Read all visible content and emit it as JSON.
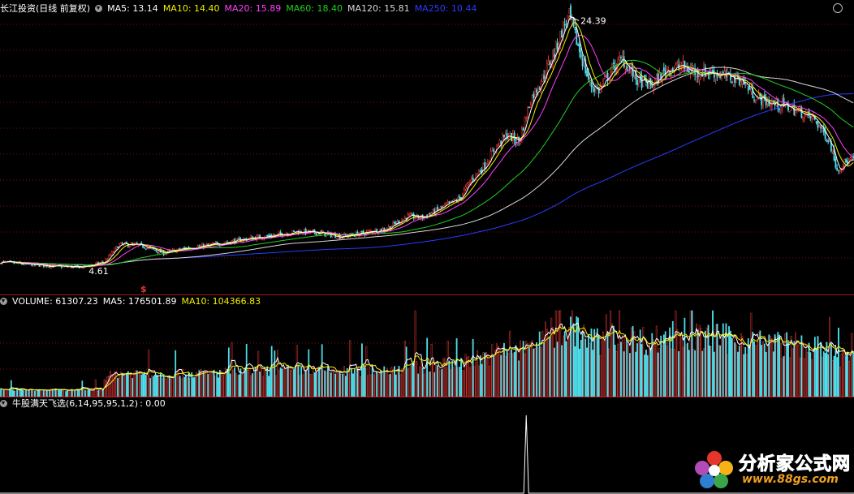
{
  "price_header": {
    "title": "长江投资(日线 前复权)",
    "ma5": "MA5: 13.14",
    "ma10": "MA10: 14.40",
    "ma20": "MA20: 15.89",
    "ma60": "MA60: 18.40",
    "ma120": "MA120: 15.81",
    "ma250": "MA250: 10.44"
  },
  "volume_header": {
    "volume": "VOLUME: 61307.23",
    "ma5": "MA5: 176501.89",
    "ma10": "MA10: 104366.83"
  },
  "indicator_header": {
    "name": "牛股满天飞选(6,14,95,95,1,2)",
    "value": ": 0.00"
  },
  "watermark": {
    "brand": "分析家公式网",
    "url": "www.88gs.com"
  },
  "colors": {
    "up": "#e23a36",
    "down": "#4fe0ee",
    "ma5": "#ffffff",
    "ma10": "#f0f000",
    "ma20": "#ff40ff",
    "ma60": "#20d020",
    "ma120": "#d8d8d8",
    "ma250": "#2a3cff",
    "separator": "#a01818"
  },
  "chart_data": {
    "type": "candlestick",
    "title": "长江投资(日线 前复权)",
    "price_range": [
      3.6,
      25.0
    ],
    "annotations": {
      "high_label": "24.39",
      "low_label": "4.61",
      "signal_marker": "$"
    },
    "keypoints": [
      [
        0,
        5.0
      ],
      [
        20,
        4.8
      ],
      [
        40,
        4.65
      ],
      [
        55,
        4.61
      ],
      [
        70,
        5.0
      ],
      [
        80,
        6.4
      ],
      [
        95,
        6.3
      ],
      [
        110,
        5.7
      ],
      [
        125,
        6.1
      ],
      [
        140,
        6.3
      ],
      [
        155,
        6.6
      ],
      [
        170,
        6.9
      ],
      [
        185,
        7.1
      ],
      [
        200,
        7.4
      ],
      [
        215,
        7.3
      ],
      [
        230,
        7.0
      ],
      [
        245,
        7.3
      ],
      [
        260,
        7.6
      ],
      [
        275,
        8.6
      ],
      [
        285,
        8.5
      ],
      [
        300,
        9.4
      ],
      [
        310,
        10.0
      ],
      [
        318,
        11.5
      ],
      [
        326,
        12.5
      ],
      [
        334,
        14.0
      ],
      [
        342,
        15.0
      ],
      [
        350,
        14.5
      ],
      [
        358,
        17.8
      ],
      [
        366,
        19.5
      ],
      [
        374,
        21.5
      ],
      [
        380,
        23.5
      ],
      [
        384,
        24.39
      ],
      [
        390,
        22.0
      ],
      [
        398,
        19.0
      ],
      [
        404,
        18.5
      ],
      [
        412,
        20.0
      ],
      [
        420,
        21.0
      ],
      [
        430,
        19.3
      ],
      [
        440,
        18.9
      ],
      [
        450,
        20.2
      ],
      [
        460,
        20.4
      ],
      [
        470,
        19.9
      ],
      [
        480,
        20.0
      ],
      [
        490,
        19.6
      ],
      [
        500,
        19.4
      ],
      [
        510,
        18.0
      ],
      [
        520,
        17.5
      ],
      [
        530,
        17.3
      ],
      [
        540,
        16.8
      ],
      [
        550,
        16.2
      ],
      [
        560,
        14.5
      ],
      [
        565,
        12.3
      ],
      [
        570,
        12.8
      ],
      [
        576,
        13.1
      ]
    ],
    "signal_spike_index": 355
  }
}
